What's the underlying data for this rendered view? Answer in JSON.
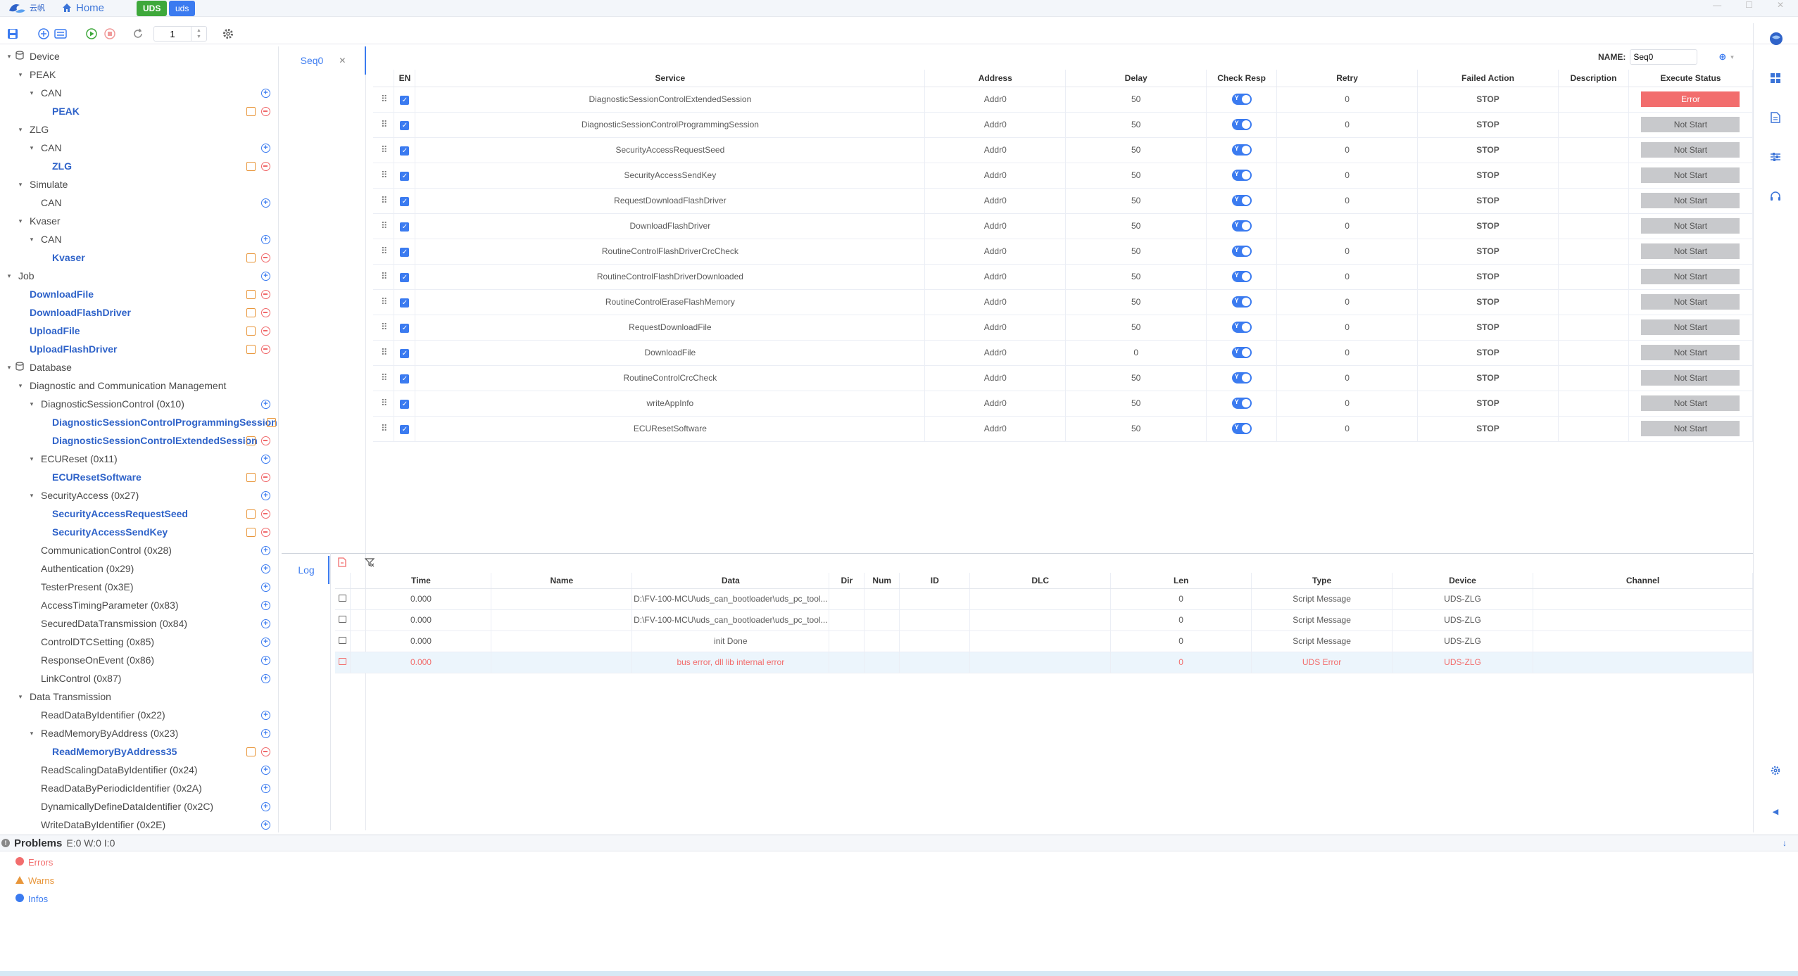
{
  "titlebar": {
    "logo_text": "云帆",
    "home": "Home",
    "tags": [
      {
        "label": "UDS",
        "color": "#3ea83b"
      },
      {
        "label": "uds",
        "color": "#3b7bf0"
      }
    ]
  },
  "toolbar": {
    "repeat_value": "1"
  },
  "tree": [
    {
      "label": "Device",
      "level": 0,
      "caret": "▾",
      "icon": "database",
      "acts": ""
    },
    {
      "label": "PEAK",
      "level": 1,
      "caret": "▾",
      "acts": ""
    },
    {
      "label": "CAN",
      "level": 2,
      "caret": "▾",
      "acts": "add"
    },
    {
      "label": "PEAK",
      "level": 3,
      "leaf": true,
      "acts": "editdel"
    },
    {
      "label": "ZLG",
      "level": 1,
      "caret": "▾",
      "acts": ""
    },
    {
      "label": "CAN",
      "level": 2,
      "caret": "▾",
      "acts": "add"
    },
    {
      "label": "ZLG",
      "level": 3,
      "leaf": true,
      "acts": "editdel"
    },
    {
      "label": "Simulate",
      "level": 1,
      "caret": "▾",
      "acts": ""
    },
    {
      "label": "CAN",
      "level": 2,
      "caret": "",
      "acts": "add"
    },
    {
      "label": "Kvaser",
      "level": 1,
      "caret": "▾",
      "acts": ""
    },
    {
      "label": "CAN",
      "level": 2,
      "caret": "▾",
      "acts": "add"
    },
    {
      "label": "Kvaser",
      "level": 3,
      "leaf": true,
      "acts": "editdel"
    },
    {
      "label": "Job",
      "level": 0,
      "caret": "▾",
      "acts": "add"
    },
    {
      "label": "DownloadFile",
      "level": 1,
      "leaf": true,
      "acts": "editdel"
    },
    {
      "label": "DownloadFlashDriver",
      "level": 1,
      "leaf": true,
      "acts": "editdel"
    },
    {
      "label": "UploadFile",
      "level": 1,
      "leaf": true,
      "acts": "editdel"
    },
    {
      "label": "UploadFlashDriver",
      "level": 1,
      "leaf": true,
      "acts": "editdel"
    },
    {
      "label": "Database",
      "level": 0,
      "caret": "▾",
      "icon": "database",
      "acts": ""
    },
    {
      "label": "Diagnostic and Communication Management",
      "level": 1,
      "caret": "▾",
      "acts": ""
    },
    {
      "label": "DiagnosticSessionControl (0x10)",
      "level": 2,
      "caret": "▾",
      "acts": "add"
    },
    {
      "label": "DiagnosticSessionControlProgrammingSession",
      "level": 3,
      "leaf": true,
      "acts": "edit"
    },
    {
      "label": "DiagnosticSessionControlExtendedSession",
      "level": 3,
      "leaf": true,
      "acts": "editdel"
    },
    {
      "label": "ECUReset (0x11)",
      "level": 2,
      "caret": "▾",
      "acts": "add"
    },
    {
      "label": "ECUResetSoftware",
      "level": 3,
      "leaf": true,
      "acts": "editdel"
    },
    {
      "label": "SecurityAccess (0x27)",
      "level": 2,
      "caret": "▾",
      "acts": "add"
    },
    {
      "label": "SecurityAccessRequestSeed",
      "level": 3,
      "leaf": true,
      "acts": "editdel"
    },
    {
      "label": "SecurityAccessSendKey",
      "level": 3,
      "leaf": true,
      "acts": "editdel"
    },
    {
      "label": "CommunicationControl (0x28)",
      "level": 2,
      "caret": "",
      "acts": "add"
    },
    {
      "label": "Authentication (0x29)",
      "level": 2,
      "caret": "",
      "acts": "add"
    },
    {
      "label": "TesterPresent (0x3E)",
      "level": 2,
      "caret": "",
      "acts": "add"
    },
    {
      "label": "AccessTimingParameter (0x83)",
      "level": 2,
      "caret": "",
      "acts": "add"
    },
    {
      "label": "SecuredDataTransmission (0x84)",
      "level": 2,
      "caret": "",
      "acts": "add"
    },
    {
      "label": "ControlDTCSetting (0x85)",
      "level": 2,
      "caret": "",
      "acts": "add"
    },
    {
      "label": "ResponseOnEvent (0x86)",
      "level": 2,
      "caret": "",
      "acts": "add"
    },
    {
      "label": "LinkControl (0x87)",
      "level": 2,
      "caret": "",
      "acts": "add"
    },
    {
      "label": "Data Transmission",
      "level": 1,
      "caret": "▾",
      "acts": ""
    },
    {
      "label": "ReadDataByIdentifier (0x22)",
      "level": 2,
      "caret": "",
      "acts": "add"
    },
    {
      "label": "ReadMemoryByAddress (0x23)",
      "level": 2,
      "caret": "▾",
      "acts": "add"
    },
    {
      "label": "ReadMemoryByAddress35",
      "level": 3,
      "leaf": true,
      "acts": "editdel"
    },
    {
      "label": "ReadScalingDataByIdentifier (0x24)",
      "level": 2,
      "caret": "",
      "acts": "add"
    },
    {
      "label": "ReadDataByPeriodicIdentifier (0x2A)",
      "level": 2,
      "caret": "",
      "acts": "add"
    },
    {
      "label": "DynamicallyDefineDataIdentifier (0x2C)",
      "level": 2,
      "caret": "",
      "acts": "add"
    },
    {
      "label": "WriteDataByIdentifier (0x2E)",
      "level": 2,
      "caret": "",
      "acts": "add"
    }
  ],
  "seq": {
    "tab": "Seq0",
    "name_label": "NAME:",
    "name_value": "Seq0",
    "columns": [
      "",
      "EN",
      "Service",
      "Address",
      "Delay",
      "Check Resp",
      "Retry",
      "Failed Action",
      "Description",
      "Execute Status"
    ],
    "toggle_text": "Y",
    "rows": [
      {
        "service": "DiagnosticSessionControlExtendedSession",
        "address": "Addr0",
        "delay": "50",
        "retry": "0",
        "failed": "STOP",
        "desc": "",
        "status": "Error"
      },
      {
        "service": "DiagnosticSessionControlProgrammingSession",
        "address": "Addr0",
        "delay": "50",
        "retry": "0",
        "failed": "STOP",
        "desc": "",
        "status": "Not Start"
      },
      {
        "service": "SecurityAccessRequestSeed",
        "address": "Addr0",
        "delay": "50",
        "retry": "0",
        "failed": "STOP",
        "desc": "",
        "status": "Not Start"
      },
      {
        "service": "SecurityAccessSendKey",
        "address": "Addr0",
        "delay": "50",
        "retry": "0",
        "failed": "STOP",
        "desc": "",
        "status": "Not Start"
      },
      {
        "service": "RequestDownloadFlashDriver",
        "address": "Addr0",
        "delay": "50",
        "retry": "0",
        "failed": "STOP",
        "desc": "",
        "status": "Not Start"
      },
      {
        "service": "DownloadFlashDriver",
        "address": "Addr0",
        "delay": "50",
        "retry": "0",
        "failed": "STOP",
        "desc": "",
        "status": "Not Start"
      },
      {
        "service": "RoutineControlFlashDriverCrcCheck",
        "address": "Addr0",
        "delay": "50",
        "retry": "0",
        "failed": "STOP",
        "desc": "",
        "status": "Not Start"
      },
      {
        "service": "RoutineControlFlashDriverDownloaded",
        "address": "Addr0",
        "delay": "50",
        "retry": "0",
        "failed": "STOP",
        "desc": "",
        "status": "Not Start"
      },
      {
        "service": "RoutineControlEraseFlashMemory",
        "address": "Addr0",
        "delay": "50",
        "retry": "0",
        "failed": "STOP",
        "desc": "",
        "status": "Not Start"
      },
      {
        "service": "RequestDownloadFile",
        "address": "Addr0",
        "delay": "50",
        "retry": "0",
        "failed": "STOP",
        "desc": "",
        "status": "Not Start"
      },
      {
        "service": "DownloadFile",
        "address": "Addr0",
        "delay": "0",
        "retry": "0",
        "failed": "STOP",
        "desc": "",
        "status": "Not Start"
      },
      {
        "service": "RoutineControlCrcCheck",
        "address": "Addr0",
        "delay": "50",
        "retry": "0",
        "failed": "STOP",
        "desc": "",
        "status": "Not Start"
      },
      {
        "service": "writeAppInfo",
        "address": "Addr0",
        "delay": "50",
        "retry": "0",
        "failed": "STOP",
        "desc": "",
        "status": "Not Start"
      },
      {
        "service": "ECUResetSoftware",
        "address": "Addr0",
        "delay": "50",
        "retry": "0",
        "failed": "STOP",
        "desc": "",
        "status": "Not Start"
      }
    ]
  },
  "log": {
    "tab": "Log",
    "columns": [
      "",
      "Time",
      "Name",
      "Data",
      "Dir",
      "Num",
      "ID",
      "DLC",
      "Len",
      "Type",
      "Device",
      "Channel"
    ],
    "rows": [
      {
        "time": "0.000",
        "name": "",
        "data": "D:\\FV-100-MCU\\uds_can_bootloader\\uds_pc_tool...",
        "dir": "",
        "num": "",
        "id": "",
        "dlc": "",
        "len": "0",
        "type": "Script Message",
        "device": "UDS-ZLG",
        "channel": "",
        "error": false
      },
      {
        "time": "0.000",
        "name": "",
        "data": "D:\\FV-100-MCU\\uds_can_bootloader\\uds_pc_tool...",
        "dir": "",
        "num": "",
        "id": "",
        "dlc": "",
        "len": "0",
        "type": "Script Message",
        "device": "UDS-ZLG",
        "channel": "",
        "error": false
      },
      {
        "time": "0.000",
        "name": "",
        "data": "init Done",
        "dir": "",
        "num": "",
        "id": "",
        "dlc": "",
        "len": "0",
        "type": "Script Message",
        "device": "UDS-ZLG",
        "channel": "",
        "error": false
      },
      {
        "time": "0.000",
        "name": "",
        "data": "bus error, dll lib internal error",
        "dir": "",
        "num": "",
        "id": "",
        "dlc": "",
        "len": "0",
        "type": "UDS Error",
        "device": "UDS-ZLG",
        "channel": "",
        "error": true
      }
    ]
  },
  "problems": {
    "title": "Problems",
    "counts": "E:0 W:0 I:0",
    "items": [
      {
        "label": "Errors",
        "color": "#f26d6d",
        "icon": "error-icon"
      },
      {
        "label": "Warns",
        "color": "#e8963a",
        "icon": "warning-icon"
      },
      {
        "label": "Infos",
        "color": "#3b7bf0",
        "icon": "info-icon"
      }
    ]
  }
}
